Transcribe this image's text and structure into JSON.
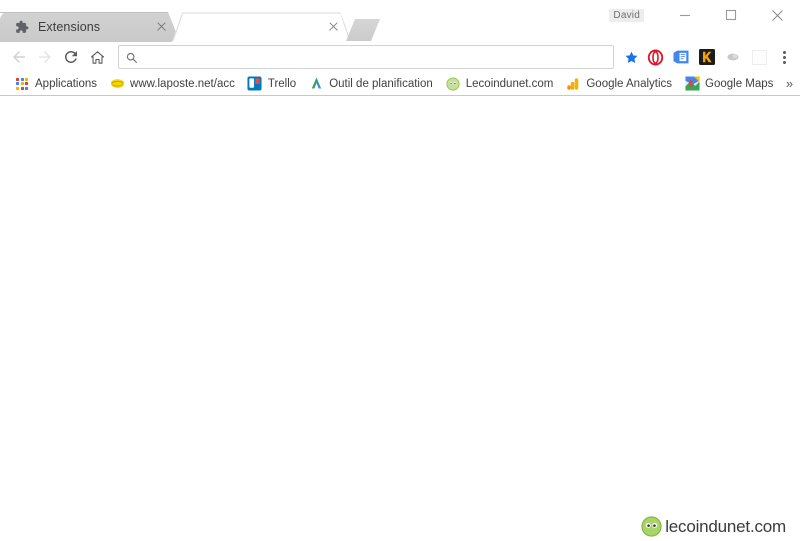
{
  "window": {
    "profile_name": "David",
    "controls": [
      {
        "name": "minimize",
        "glyph": "–"
      },
      {
        "name": "maximize",
        "glyph": "□"
      },
      {
        "name": "close",
        "glyph": "✕"
      }
    ]
  },
  "tabs": [
    {
      "title": "Extensions",
      "favicon": "puzzle-piece-icon",
      "active": false,
      "close_label": "Close tab"
    },
    {
      "title": "",
      "favicon": "none",
      "active": true,
      "close_label": "Close tab"
    }
  ],
  "new_tab": {
    "tooltip": "New tab"
  },
  "toolbar": {
    "back": {
      "name": "back-icon",
      "enabled": false
    },
    "forward": {
      "name": "forward-icon",
      "enabled": false
    },
    "reload": {
      "name": "reload-icon",
      "enabled": true
    },
    "home": {
      "name": "home-icon",
      "enabled": true
    },
    "omnibox": {
      "value": "",
      "placeholder": "",
      "leading_icon": "search-icon",
      "star_icon": "bookmark-star-icon",
      "star_active": true
    },
    "extensions": [
      {
        "name": "opera-extension-icon",
        "color": "#d7182a",
        "label": "Opera"
      },
      {
        "name": "evernote-clipper-icon",
        "color": "#4285f4",
        "label": "Web Clipper"
      },
      {
        "name": "kaspersky-extension-icon",
        "color": "#f0a500",
        "label": "Kaspersky"
      },
      {
        "name": "grayed-extension-icon",
        "color": "#bdbdbd",
        "label": "Extension"
      },
      {
        "name": "blank-extension-icon",
        "color": "#fbfbfb",
        "label": "Extension"
      }
    ],
    "menu": {
      "name": "three-dot-menu-icon",
      "label": "Customize and control Google Chrome"
    }
  },
  "bookmarks": {
    "items": [
      {
        "label": "Applications",
        "icon": "apps-grid-icon"
      },
      {
        "label": "www.laposte.net/acc",
        "icon": "laposte-icon"
      },
      {
        "label": "Trello",
        "icon": "trello-icon"
      },
      {
        "label": "Outil de planification",
        "icon": "google-ads-icon"
      },
      {
        "label": "Lecoindunet.com",
        "icon": "lecoindunet-icon"
      },
      {
        "label": "Google Analytics",
        "icon": "google-analytics-icon"
      },
      {
        "label": "Google Maps",
        "icon": "google-maps-icon"
      }
    ],
    "overflow": {
      "label": "»",
      "name": "bookmarks-overflow-icon"
    }
  },
  "content": {
    "background": "#ffffff",
    "body_text": ""
  },
  "watermark": {
    "text": "lecoindunet.com",
    "logo_name": "lecoindunet-logo-icon",
    "logo_color": "#8cc63f"
  }
}
